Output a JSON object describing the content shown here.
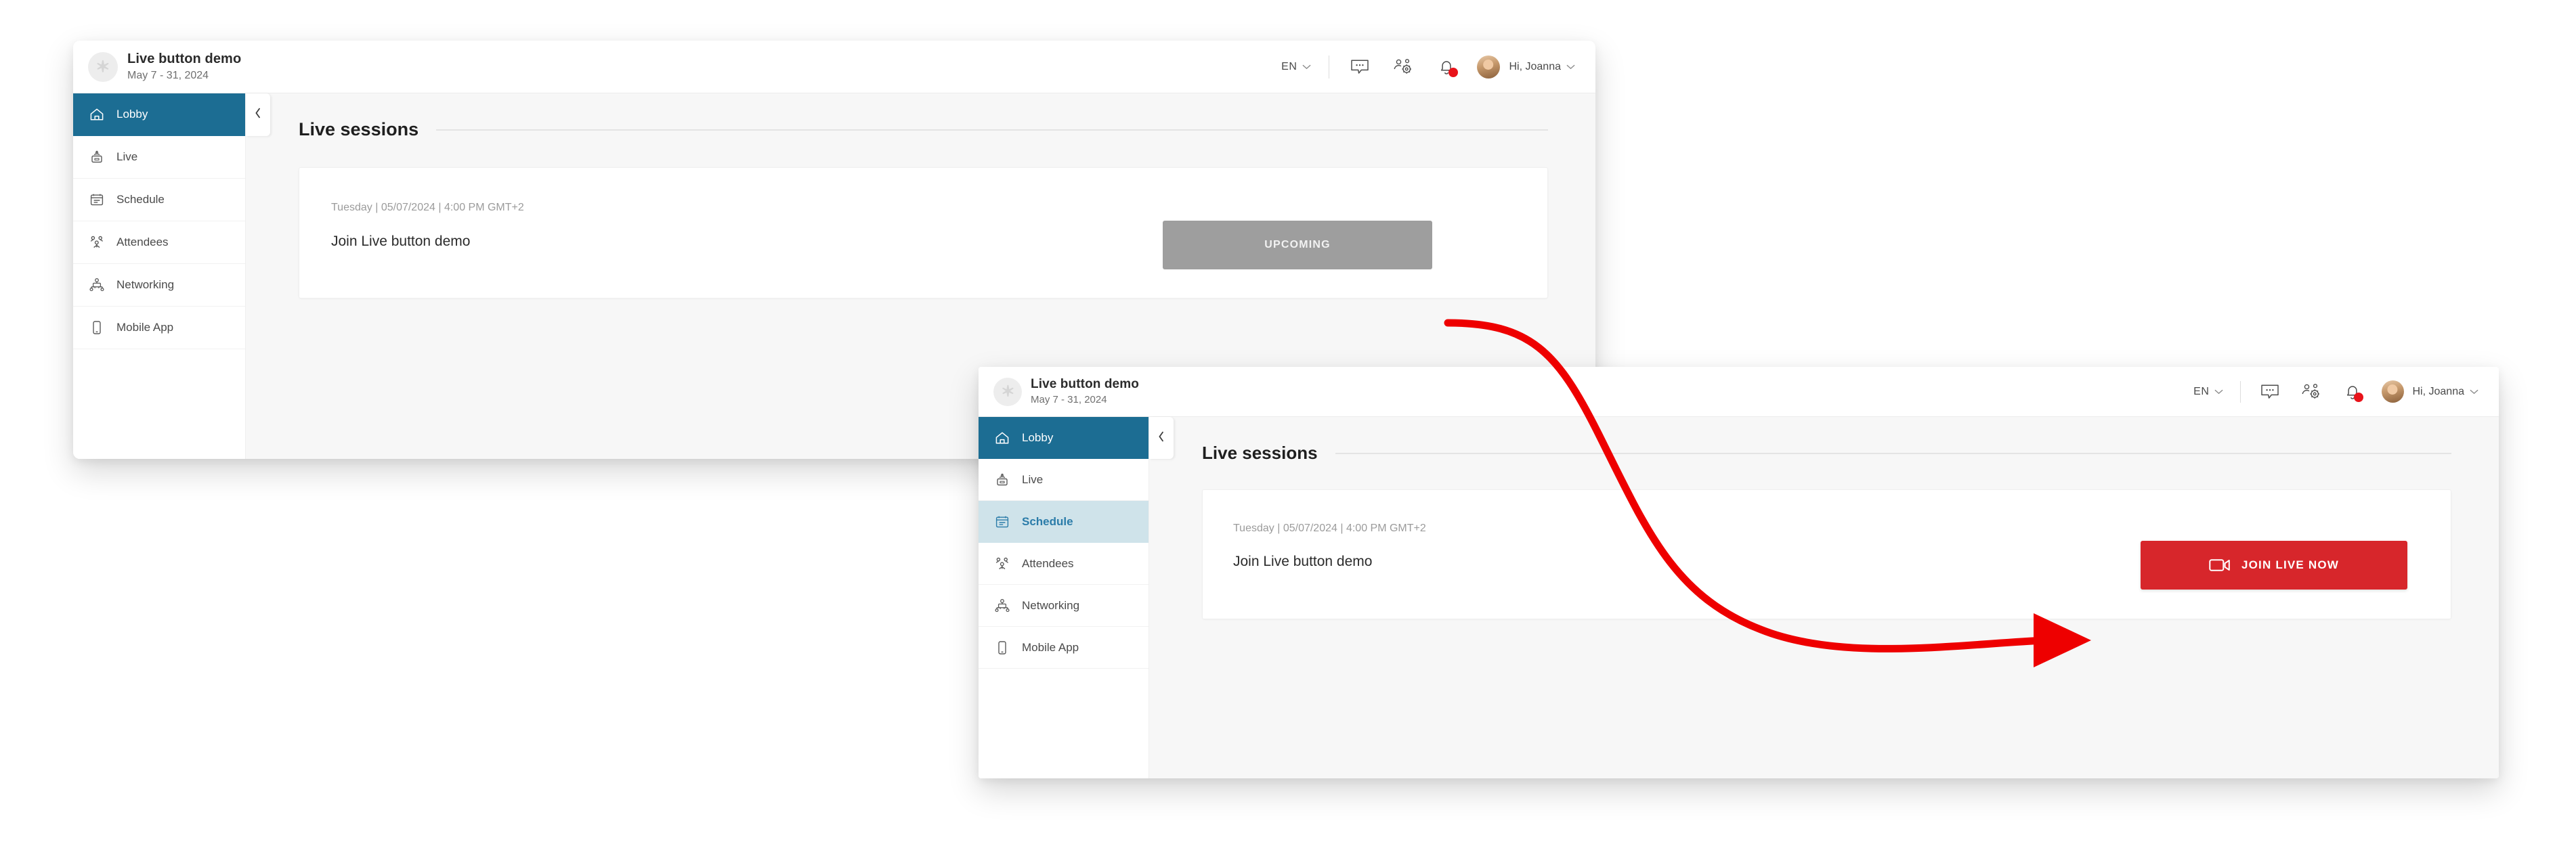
{
  "colors": {
    "accent_blue": "#1c6d93",
    "accent_blue_light": "#cfe3ea",
    "accent_blue_text": "#2b7ca9",
    "upcoming_gray": "#9e9e9e",
    "join_red": "#d7262b",
    "arrow_red": "#ee0000",
    "page_bg": "#f7f7f7"
  },
  "window_before": {
    "topbar": {
      "logo_icon": "star-icon",
      "title": "Live button demo",
      "subtitle": "May 7 - 31, 2024",
      "language": "EN",
      "language_caret": "chevron-down-icon",
      "chat_icon": "chat-bubble-icon",
      "matchmaking_icon": "people-gear-icon",
      "notifications_icon": "bell-icon",
      "notifications_has_badge": true,
      "avatar_icon": "user-avatar",
      "greeting": "Hi, Joanna",
      "greeting_caret": "chevron-down-icon"
    },
    "sidebar": {
      "collapse_icon": "chevron-left-icon",
      "items": [
        {
          "label": "Lobby",
          "icon": "home-icon",
          "state": "active-dark"
        },
        {
          "label": "Live",
          "icon": "live-icon",
          "state": "default"
        },
        {
          "label": "Schedule",
          "icon": "calendar-icon",
          "state": "default"
        },
        {
          "label": "Attendees",
          "icon": "attendees-icon",
          "state": "default"
        },
        {
          "label": "Networking",
          "icon": "networking-icon",
          "state": "default"
        },
        {
          "label": "Mobile App",
          "icon": "mobile-icon",
          "state": "default"
        }
      ]
    },
    "main": {
      "section_title": "Live sessions",
      "session": {
        "meta": "Tuesday | 05/07/2024 | 4:00 PM GMT+2",
        "title": "Join Live button demo",
        "button_label": "UPCOMING",
        "button_state": "disabled"
      }
    }
  },
  "window_after": {
    "topbar": {
      "logo_icon": "star-icon",
      "title": "Live button demo",
      "subtitle": "May 7 - 31, 2024",
      "language": "EN",
      "language_caret": "chevron-down-icon",
      "chat_icon": "chat-bubble-icon",
      "matchmaking_icon": "people-gear-icon",
      "notifications_icon": "bell-icon",
      "notifications_has_badge": true,
      "avatar_icon": "user-avatar",
      "greeting": "Hi, Joanna",
      "greeting_caret": "chevron-down-icon"
    },
    "sidebar": {
      "collapse_icon": "chevron-left-icon",
      "items": [
        {
          "label": "Lobby",
          "icon": "home-icon",
          "state": "active-dark"
        },
        {
          "label": "Live",
          "icon": "live-icon",
          "state": "default"
        },
        {
          "label": "Schedule",
          "icon": "calendar-icon",
          "state": "active-light"
        },
        {
          "label": "Attendees",
          "icon": "attendees-icon",
          "state": "default"
        },
        {
          "label": "Networking",
          "icon": "networking-icon",
          "state": "default"
        },
        {
          "label": "Mobile App",
          "icon": "mobile-icon",
          "state": "default"
        }
      ]
    },
    "main": {
      "section_title": "Live sessions",
      "session": {
        "meta": "Tuesday | 05/07/2024 | 4:00 PM GMT+2",
        "title": "Join Live button demo",
        "button_label": "JOIN LIVE NOW",
        "button_icon": "video-camera-icon",
        "button_state": "active"
      }
    }
  },
  "annotation": {
    "arrow_icon": "curved-arrow-icon",
    "from": "upcoming-button",
    "to": "join-live-now-button"
  }
}
